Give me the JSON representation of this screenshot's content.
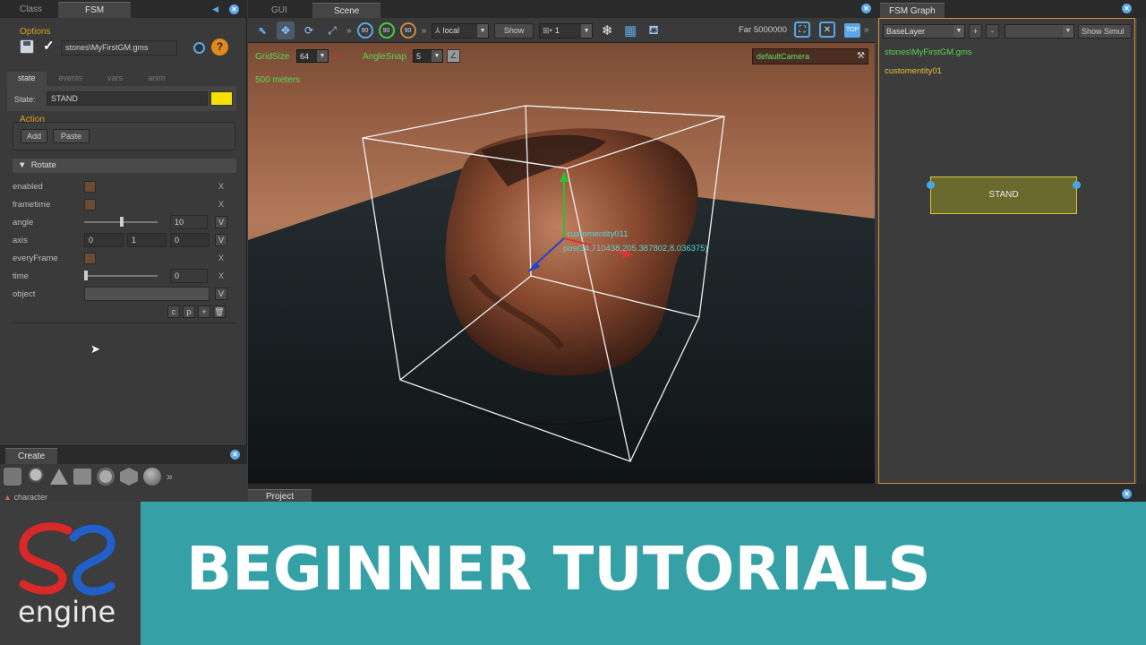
{
  "left_panel": {
    "top_tabs": [
      "Class",
      "FSM"
    ],
    "options_legend": "Options",
    "file_path": "stones\\MyFirstGM.gms",
    "sub_tabs": [
      "state",
      "events",
      "vars",
      "anim"
    ],
    "state_label": "State:",
    "state_value": "STAND",
    "state_color": "#f5e000",
    "action_legend": "Action",
    "add_button": "Add",
    "paste_button": "Paste",
    "action_header": "Rotate",
    "props": {
      "enabled": "enabled",
      "frametime": "frametime",
      "angle": "angle",
      "angle_value": "10",
      "axis": "axis",
      "axis_x": "0",
      "axis_y": "1",
      "axis_z": "0",
      "everyframe": "everyFrame",
      "time": "time",
      "time_value": "0",
      "object": "object"
    },
    "x_label": "X",
    "v_label": "V",
    "row_buttons": [
      "c",
      "p",
      "+"
    ],
    "create_tab": "Create",
    "create_item": "character"
  },
  "scene": {
    "tabs": [
      "GUI",
      "Scene"
    ],
    "space_select": "local",
    "show_button": "Show",
    "layer_select": "1",
    "far_label": "Far",
    "far_value": "5000000",
    "top_button": "TOP",
    "grid_size_label": "GridSize",
    "grid_size_value": "64",
    "angle_snap_label": "AngleSnap",
    "angle_snap_value": "5",
    "distance_text": "500 meters",
    "camera_select": "defaultCamera",
    "entity_name": "customentity011",
    "entity_pos": "pos(34.710438,205.387802,8.036375)",
    "rot_labels": [
      "90",
      "90",
      "90"
    ],
    "project_tab": "Project"
  },
  "fsm_graph": {
    "tab": "FSM Graph",
    "layer_select": "BaseLayer",
    "plus": "+",
    "minus": "-",
    "show_simul": "Show Simul",
    "file": "stones\\MyFirstGM.gms",
    "entity": "customentity01",
    "node_label": "STAND"
  },
  "banner": {
    "logo_text": "engine",
    "title": "BEGINNER TUTORIALS"
  },
  "colors": {
    "accent_blue": "#5aa7e8",
    "accent_orange": "#e09030",
    "banner_teal": "#35a1a6",
    "overlay_green": "#57d657"
  }
}
